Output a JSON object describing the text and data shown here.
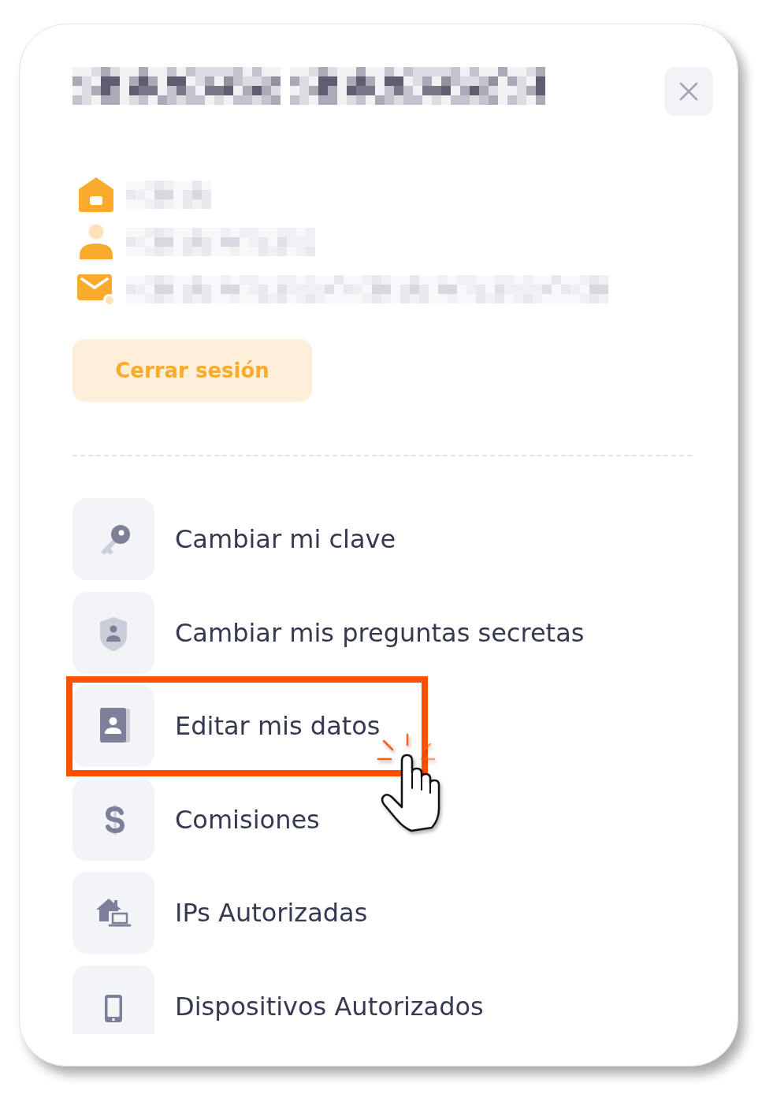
{
  "logout_button": {
    "label": "Cerrar sesión"
  },
  "menu": [
    {
      "label": "Cambiar mi clave",
      "highlighted": false
    },
    {
      "label": "Cambiar mis preguntas secretas",
      "highlighted": false
    },
    {
      "label": "Editar mis datos",
      "highlighted": true
    },
    {
      "label": "Comisiones",
      "highlighted": false
    },
    {
      "label": "IPs Autorizadas",
      "highlighted": false
    },
    {
      "label": "Dispositivos Autorizados",
      "highlighted": false
    }
  ]
}
